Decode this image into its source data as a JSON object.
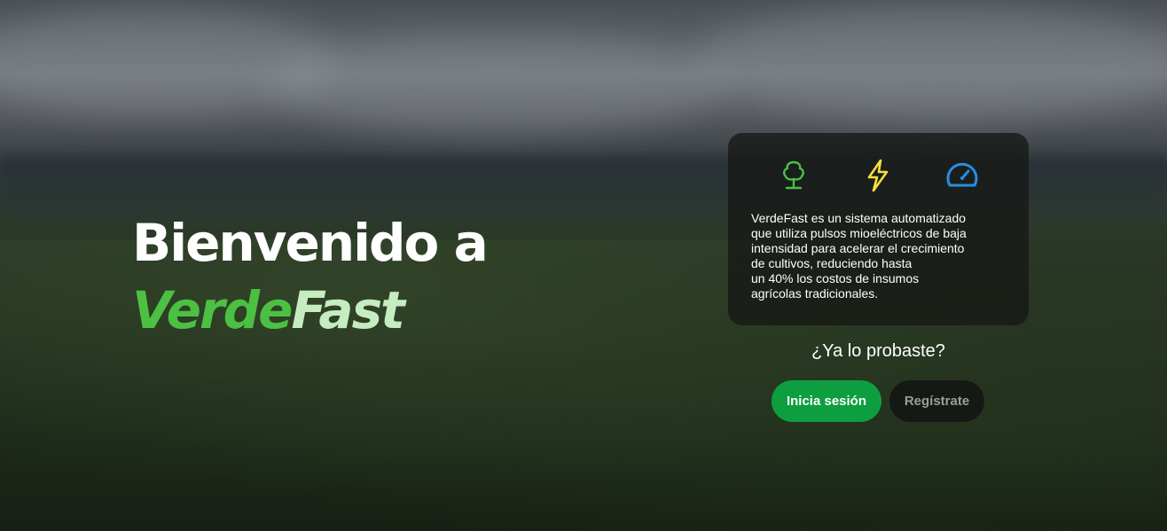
{
  "hero": {
    "line1": "Bienvenido a",
    "brand_part1": "Verde",
    "brand_part2": "Fast"
  },
  "info_card": {
    "icons": [
      {
        "name": "tree-icon",
        "color": "#4cc043"
      },
      {
        "name": "lightning-icon",
        "color": "#f5e03a"
      },
      {
        "name": "speedometer-icon",
        "color": "#2a8de0"
      }
    ],
    "description": "VerdeFast es un sistema automatizado\nque utiliza pulsos mioeléctricos de baja\nintensidad para acelerar el crecimiento\nde cultivos, reduciendo hasta\nun 40% los costos de insumos\nagrícolas tradicionales."
  },
  "cta": {
    "prompt": "¿Ya lo probaste?",
    "login_label": "Inicia sesión",
    "register_label": "Regístrate"
  },
  "colors": {
    "brand_green": "#4cc043",
    "brand_light": "#c6ecc2",
    "button_green": "#0d9f3f"
  }
}
